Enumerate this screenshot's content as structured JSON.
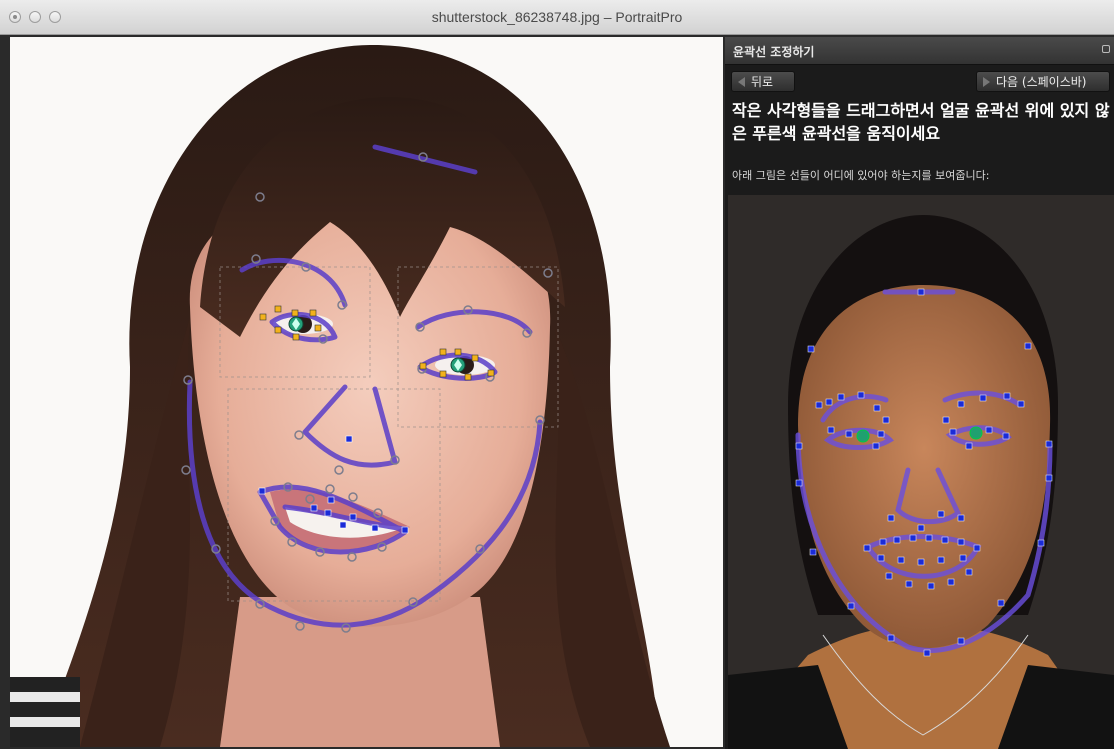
{
  "window": {
    "title": "shutterstock_86238748.jpg – PortraitPro"
  },
  "panel": {
    "title": "윤곽선 조정하기",
    "back_label": "뒤로",
    "next_label": "다음 (스페이스바)",
    "instruction": "작은 사각형들을 드래그하면서 얼굴 윤곽선 위에 있지 않은 푸른색 윤곽선을 움직이세요",
    "subtext": "아래 그림은 선들이 어디에 있어야 하는지를 보여줍니다:"
  },
  "colors": {
    "outline": "#5b3fc9",
    "handle_yellow": "#f2b21b",
    "handle_blue": "#1a2bd8",
    "point_gray": "#8a8a9a",
    "panel_bg": "#1b1b1b"
  },
  "icons": [
    "window-close-icon",
    "window-minimize-icon",
    "window-zoom-icon",
    "panel-collapse-icon",
    "back-arrow-icon",
    "next-arrow-icon"
  ]
}
